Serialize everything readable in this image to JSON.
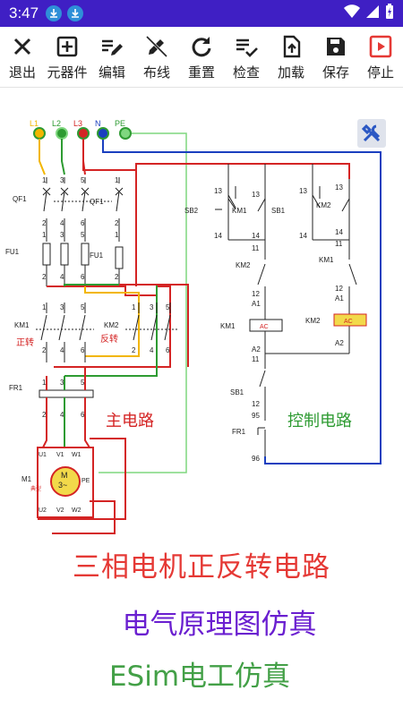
{
  "status": {
    "time": "3:47"
  },
  "toolbar": {
    "items": [
      {
        "label": "退出",
        "icon": "close-icon"
      },
      {
        "label": "元器件",
        "icon": "add-box-icon"
      },
      {
        "label": "编辑",
        "icon": "edit-list-icon"
      },
      {
        "label": "布线",
        "icon": "pen-off-icon"
      },
      {
        "label": "重置",
        "icon": "refresh-icon"
      },
      {
        "label": "检查",
        "icon": "checklist-icon"
      },
      {
        "label": "加载",
        "icon": "upload-icon"
      },
      {
        "label": "保存",
        "icon": "save-icon"
      },
      {
        "label": "停止",
        "icon": "stop-play-icon"
      }
    ]
  },
  "circuit": {
    "phases": {
      "l1": "L1",
      "l2": "L2",
      "l3": "L3",
      "n": "N",
      "pe": "PE"
    },
    "labels": {
      "qf1_left": "QF1",
      "qf1_right": "QF1",
      "fu1_left": "FU1",
      "fu1_right": "FU1",
      "km1": "KM1",
      "zhengzhuan": "正转",
      "km2": "KM2",
      "fanzhuan": "反转",
      "fr1": "FR1",
      "main_circuit": "主电路",
      "control_circuit": "控制电路",
      "m1": "M1",
      "motor_m": "M",
      "motor_3": "3~",
      "pe_term": "PE",
      "dianxing": "典型",
      "sb2": "SB2",
      "sb1": "SB1",
      "ac": "AC"
    },
    "colors": {
      "yellow": "#f2b600",
      "green": "#2e9b32",
      "red": "#d42424",
      "blue": "#1a3fbf",
      "pe": "#7fd77f",
      "black": "#222222"
    }
  },
  "captions": {
    "title": "三相电机正反转电路",
    "subtitle": "电气原理图仿真",
    "brand": "ESim电工仿真"
  }
}
